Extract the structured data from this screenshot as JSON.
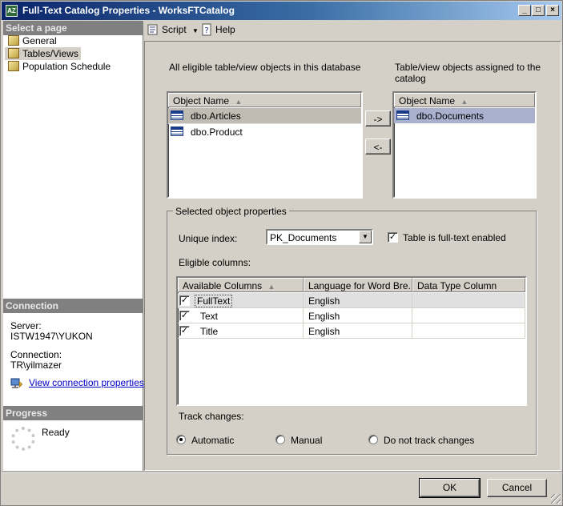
{
  "window": {
    "title": "Full-Text Catalog Properties - WorksFTCatalog",
    "app_icon": "AZ"
  },
  "left_panel": {
    "select_page_header": "Select a page",
    "pages": [
      {
        "label": "General",
        "selected": false
      },
      {
        "label": "Tables/Views",
        "selected": true
      },
      {
        "label": "Population Schedule",
        "selected": false
      }
    ],
    "connection_header": "Connection",
    "server_label": "Server:",
    "server_value": "ISTW1947\\YUKON",
    "connection_label": "Connection:",
    "connection_value": "TR\\yilmazer",
    "view_connection_link": "View connection properties",
    "progress_header": "Progress",
    "progress_status": "Ready"
  },
  "toolbar": {
    "script_label": "Script",
    "help_label": "Help"
  },
  "main": {
    "eligible_label": "All eligible table/view objects in this database",
    "assigned_label_line1": "Table/view objects assigned to the",
    "assigned_label_line2": "catalog",
    "eligible_list": {
      "header": "Object Name",
      "items": [
        {
          "name": "dbo.Articles",
          "selected": true
        },
        {
          "name": "dbo.Product",
          "selected": false
        }
      ]
    },
    "assigned_list": {
      "header": "Object Name",
      "items": [
        {
          "name": "dbo.Documents",
          "selected": true
        }
      ]
    },
    "move_right_label": "->",
    "move_left_label": "<-",
    "selected_props_title": "Selected object properties",
    "unique_index_label": "Unique index:",
    "unique_index_value": "PK_Documents",
    "fulltext_enabled_label": "Table is full-text enabled",
    "fulltext_enabled_checked": true,
    "eligible_columns_label": "Eligible columns:",
    "columns_headers": [
      "Available Columns",
      "Language for Word Bre...",
      "Data Type Column"
    ],
    "columns": [
      {
        "checked": true,
        "name": "FullText",
        "language": "English",
        "datatype": ""
      },
      {
        "checked": true,
        "name": "Text",
        "language": "English",
        "datatype": ""
      },
      {
        "checked": true,
        "name": "Title",
        "language": "English",
        "datatype": ""
      }
    ],
    "track_changes_label": "Track changes:",
    "track_options": [
      {
        "label": "Automatic",
        "selected": true
      },
      {
        "label": "Manual",
        "selected": false
      },
      {
        "label": "Do not track changes",
        "selected": false
      }
    ]
  },
  "footer": {
    "ok_label": "OK",
    "cancel_label": "Cancel"
  },
  "colors": {
    "titlebar_start": "#0a246a",
    "titlebar_end": "#a6caf0",
    "face": "#d4d0c8",
    "link": "#0000cc",
    "section_header": "#808080"
  }
}
